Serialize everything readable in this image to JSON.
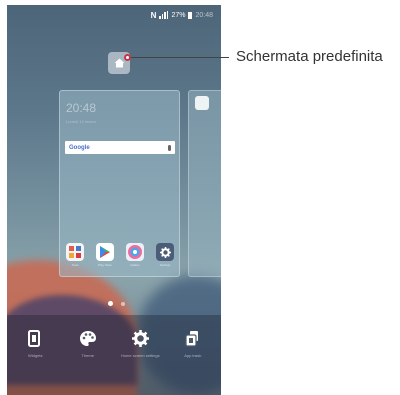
{
  "status_bar": {
    "nfc": "N",
    "battery": "27%",
    "clock": "20:48"
  },
  "card": {
    "clock": "20:48",
    "date": "Lunedì 12 marzo",
    "search_brand": "Google"
  },
  "dock_apps": [
    {
      "label": "Tools",
      "icon": "tools-folder-icon"
    },
    {
      "label": "Play Store",
      "icon": "play-store-icon"
    },
    {
      "label": "Gallery",
      "icon": "gallery-icon"
    },
    {
      "label": "Settings",
      "icon": "settings-icon"
    }
  ],
  "pages": {
    "count": 2,
    "current": 1
  },
  "options": [
    {
      "label": "Widgets",
      "icon": "widgets-icon"
    },
    {
      "label": "Theme",
      "icon": "palette-icon"
    },
    {
      "label": "Home screen settings",
      "icon": "gear-icon"
    },
    {
      "label": "App trash",
      "icon": "app-trash-icon"
    }
  ],
  "callout": {
    "label": "Schermata predefinita"
  },
  "colors": {
    "callout_dot_border": "#c8344a",
    "callout_text": "#333333"
  }
}
